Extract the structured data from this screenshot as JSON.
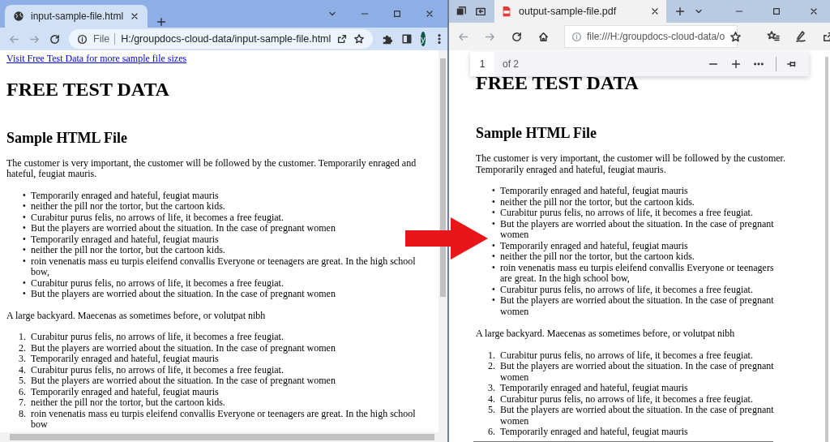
{
  "left_window": {
    "tab": {
      "title": "input-sample-file.html"
    },
    "address_bar": {
      "scheme_label": "File",
      "url": "H:/groupdocs-cloud-data/input-sample-file.html"
    },
    "profile_initial": "y",
    "document": [
      {
        "kind": "link",
        "text": "Visit Free Test Data for more sample file sizes"
      },
      {
        "kind": "h1",
        "text": "FREE TEST DATA"
      },
      {
        "kind": "h2",
        "text": "Sample HTML File"
      },
      {
        "kind": "paragraph",
        "text": "The customer is very important, the customer will be followed by the customer. Temporarily enraged and hateful, feugiat mauris."
      },
      {
        "kind": "list",
        "items": [
          {
            "marker": "•",
            "text": "Temporarily enraged and hateful, feugiat mauris"
          },
          {
            "marker": "•",
            "text": "neither the pill nor the tortor, but the cartoon kids."
          },
          {
            "marker": "•",
            "text": "Curabitur purus felis, no arrows of life, it becomes a free feugiat."
          },
          {
            "marker": "•",
            "text": "But the players are worried about the situation. In the case of pregnant women"
          },
          {
            "marker": "•",
            "text": "Temporarily enraged and hateful, feugiat mauris"
          },
          {
            "marker": "•",
            "text": "neither the pill nor the tortor, but the cartoon kids."
          },
          {
            "marker": "•",
            "text": "roin venenatis mass eu turpis eleifend convallis Everyone or teenagers are great. In the high school bow,"
          },
          {
            "marker": "•",
            "text": "Curabitur purus felis, no arrows of life, it becomes a free feugiat."
          },
          {
            "marker": "•",
            "text": "But the players are worried about the situation. In the case of pregnant women"
          }
        ]
      },
      {
        "kind": "paragraph",
        "text": "A large backyard. Maecenas as sometimes before, or volutpat nibh"
      },
      {
        "kind": "list",
        "items": [
          {
            "marker": "1.",
            "text": "Curabitur purus felis, no arrows of life, it becomes a free feugiat."
          },
          {
            "marker": "2.",
            "text": "But the players are worried about the situation. In the case of pregnant women"
          },
          {
            "marker": "3.",
            "text": "Temporarily enraged and hateful, feugiat mauris"
          },
          {
            "marker": "4.",
            "text": "Curabitur purus felis, no arrows of life, it becomes a free feugiat."
          },
          {
            "marker": "5.",
            "text": "But the players are worried about the situation. In the case of pregnant women"
          },
          {
            "marker": "6.",
            "text": "Temporarily enraged and hateful, feugiat mauris"
          },
          {
            "marker": "7.",
            "text": "neither the pill nor the tortor, but the cartoon kids."
          },
          {
            "marker": "8.",
            "text": "roin venenatis mass eu turpis eleifend convallis Everyone or teenagers are great. In the high school bow"
          }
        ]
      }
    ]
  },
  "right_window": {
    "tab": {
      "title": "output-sample-file.pdf"
    },
    "address_bar": {
      "url": "file:///H:/groupdocs-cloud-data/o"
    },
    "pdf_toolbar": {
      "page_number": "1",
      "page_count": "of 2"
    },
    "document": [
      {
        "kind": "h1",
        "text": "FREE TEST DATA"
      },
      {
        "kind": "h2",
        "text": "Sample HTML File"
      },
      {
        "kind": "paragraph",
        "text": "The customer is very important, the customer will be followed by the customer. Temporarily enraged and hateful, feugiat mauris."
      },
      {
        "kind": "list",
        "items": [
          {
            "marker": "•",
            "text": "Temporarily enraged and hateful, feugiat mauris"
          },
          {
            "marker": "•",
            "text": "neither the pill nor the tortor, but the cartoon kids."
          },
          {
            "marker": "•",
            "text": "Curabitur purus felis, no arrows of life, it becomes a free feugiat."
          },
          {
            "marker": "•",
            "text": "But the players are worried about the situation. In the case of pregnant women"
          },
          {
            "marker": "•",
            "text": "Temporarily enraged and hateful, feugiat mauris"
          },
          {
            "marker": "•",
            "text": "neither the pill nor the tortor, but the cartoon kids."
          },
          {
            "marker": "•",
            "text": "roin venenatis mass eu turpis eleifend convallis Everyone or teenagers are great. In the high school bow,"
          },
          {
            "marker": "•",
            "text": "Curabitur purus felis, no arrows of life, it becomes a free feugiat."
          },
          {
            "marker": "•",
            "text": "But the players are worried about the situation. In the case of pregnant women"
          }
        ]
      },
      {
        "kind": "paragraph",
        "text": "A large backyard. Maecenas as sometimes before, or volutpat nibh"
      },
      {
        "kind": "list",
        "items": [
          {
            "marker": "1.",
            "text": "Curabitur purus felis, no arrows of life, it becomes a free feugiat."
          },
          {
            "marker": "2.",
            "text": "But the players are worried about the situation. In the case of pregnant women"
          },
          {
            "marker": "3.",
            "text": "Temporarily enraged and hateful, feugiat mauris"
          },
          {
            "marker": "4.",
            "text": "Curabitur purus felis, no arrows of life, it becomes a free feugiat."
          },
          {
            "marker": "5.",
            "text": "But the players are worried about the situation. In the case of pregnant women"
          },
          {
            "marker": "6.",
            "text": "Temporarily enraged and hateful, feugiat mauris"
          }
        ]
      }
    ]
  }
}
